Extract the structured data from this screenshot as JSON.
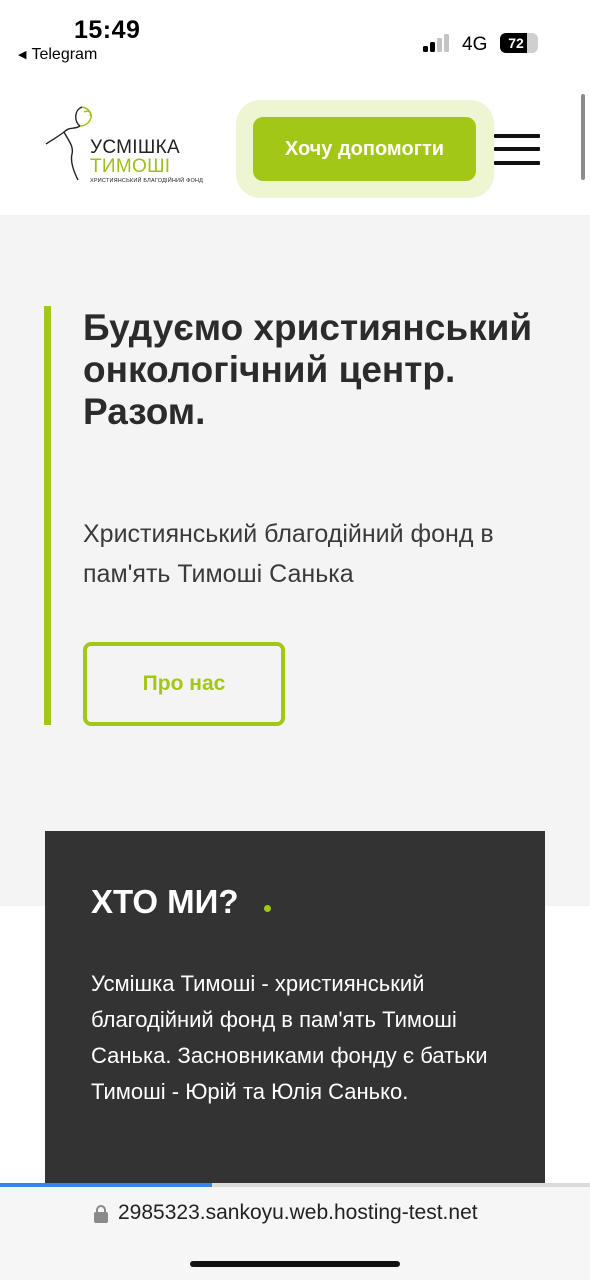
{
  "status_bar": {
    "time": "15:49",
    "back_app": "Telegram",
    "network": "4G",
    "battery_level": "72",
    "battery_fraction": 0.72,
    "signal_bars_active": 2,
    "signal_bars_total": 4
  },
  "header": {
    "logo": {
      "line1": "УСМІШКА",
      "line2": "ТИМОШІ",
      "subtitle": "ХРИСТИЯНСЬКИЙ БЛАГОДІЙНИЙ ФОНД"
    },
    "cta_label": "Хочу допомогти",
    "menu_icon": "hamburger-icon"
  },
  "hero": {
    "title": "Будуємо християнський онкологічний центр. Разом.",
    "subtitle": "Християнський благодійний фонд в пам'ять Тимоші Санька",
    "about_button": "Про нас"
  },
  "who": {
    "title": "ХТО МИ?",
    "text": "Усмішка Тимоші - християнський благодійний фонд в пам'ять Тимоші Санька. Засновниками фонду є батьки Тимоші - Юрій та Юлія Санько."
  },
  "browser": {
    "url": "2985323.sankoyu.web.hosting-test.net",
    "load_progress": 0.36
  },
  "colors": {
    "accent": "#a3c716",
    "accent_light": "#eef5d2",
    "hero_bg": "#f4f4f4",
    "card_bg": "#333333",
    "progress": "#3b82e6"
  }
}
